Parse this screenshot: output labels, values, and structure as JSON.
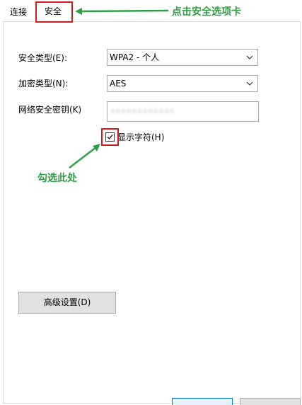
{
  "tabs": {
    "connection": "连接",
    "security": "安全"
  },
  "fields": {
    "security_type_label": "安全类型(E):",
    "security_type_value": "WPA2 - 个人",
    "encryption_type_label": "加密类型(N):",
    "encryption_type_value": "AES",
    "network_key_label": "网络安全密钥(K)",
    "network_key_value": "••••••••••••"
  },
  "show_characters": {
    "label": "显示字符(H)",
    "checked": true
  },
  "advanced_button": "高级设置(D)",
  "annotations": {
    "click_tab": "点击安全选项卡",
    "check_here": "勾选此处",
    "color": "#2f9e44",
    "highlight_color": "#d01c1c"
  },
  "icons": {
    "dropdown": "chevron-down-icon",
    "check": "checkmark-icon"
  }
}
